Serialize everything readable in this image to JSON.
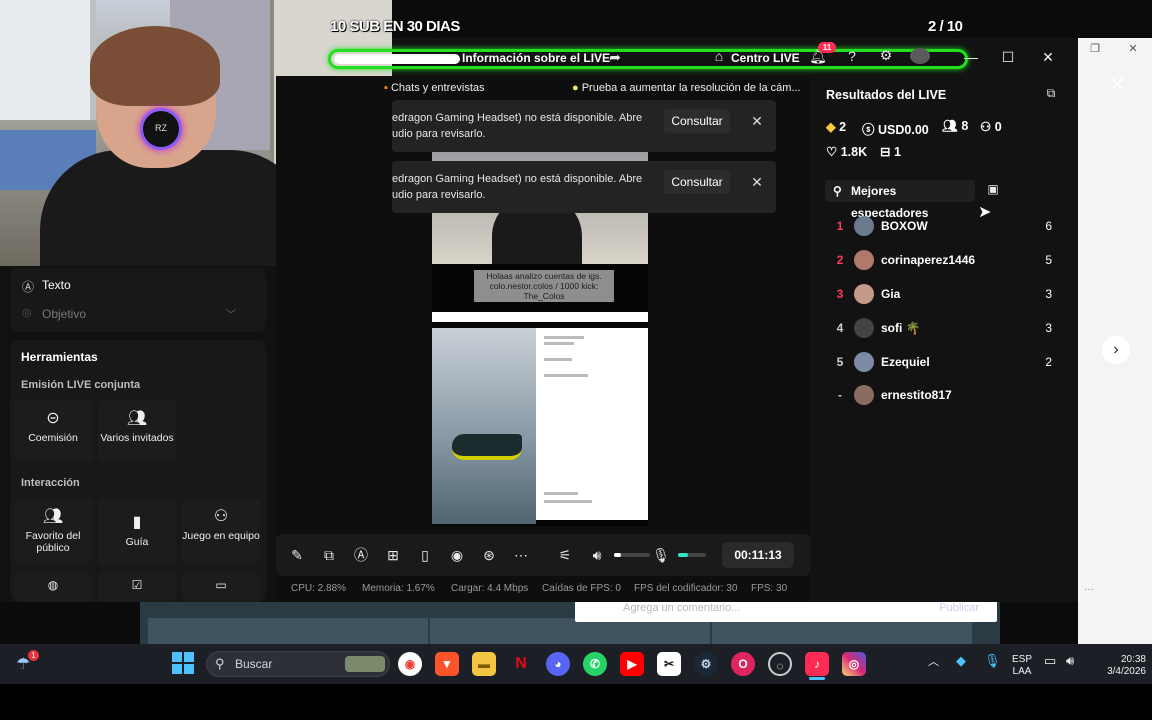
{
  "overlay": {
    "goal_text": "10 SUB EN 30 DIAS",
    "goal_count": "2 / 10",
    "goal_progress": 0.2
  },
  "topbar": {
    "live_info": "Información sobre el LIVE",
    "centro_live": "Centro LIVE",
    "notif_count": "11"
  },
  "subbar": {
    "chats": "Chats y entrevistas",
    "tip": "Prueba a aumentar la resolución de la cám..."
  },
  "notices": [
    {
      "text1": "edragon Gaming Headset) no está disponible. Abre",
      "text2": "udio para revisarlo.",
      "button": "Consultar"
    },
    {
      "text1": "edragon Gaming Headset) no está disponible. Abre",
      "text2": "udio para revisarlo.",
      "button": "Consultar"
    }
  ],
  "preview": {
    "caption": "Holaas analizo cuentas de igs. colo.nestor.colos / 1000 kick: The_Colos"
  },
  "left_panel": {
    "texto": "Texto",
    "objetivo": "Objetivo",
    "herramientas": "Herramientas",
    "emision": "Emisión LIVE conjunta",
    "coemision": "Coemisión",
    "varios": "Varios invitados",
    "interaccion": "Interacción",
    "favorito": "Favorito del público",
    "guia": "Guía",
    "juego": "Juego en equipo"
  },
  "controls": {
    "timer": "00:11:13",
    "volume_level": 0.2,
    "mic_level": 0.35
  },
  "stats": {
    "cpu": "CPU: 2.88%",
    "memoria": "Memoria: 1.67%",
    "cargar": "Cargar: 4.4 Mbps",
    "caidas": "Caídas de FPS: 0",
    "fps_cod": "FPS del codificador: 30",
    "fps": "FPS: 30"
  },
  "results": {
    "title": "Resultados del LIVE",
    "diamonds": "2",
    "usd": "USD0.00",
    "viewers": "8",
    "new_followers": "0",
    "likes": "1.8K",
    "shares": "1",
    "tab": "Mejores espectadores",
    "ranking": [
      {
        "rank": "1",
        "name": "BOXOW",
        "score": "6",
        "rank_color": "#ff3b5c",
        "avatar_color": "#6b7a8f"
      },
      {
        "rank": "2",
        "name": "corinaperez1446",
        "score": "5",
        "rank_color": "#ff3b5c",
        "avatar_color": "#b07a6a"
      },
      {
        "rank": "3",
        "name": "Gia",
        "score": "3",
        "rank_color": "#ff3b5c",
        "avatar_color": "#c49a8a"
      },
      {
        "rank": "4",
        "name": "sofi 🌴",
        "score": "3",
        "rank_color": "#cfcfcf",
        "avatar_color": "#444"
      },
      {
        "rank": "5",
        "name": "Ezequiel",
        "score": "2",
        "rank_color": "#cfcfcf",
        "avatar_color": "#7d8aa3"
      },
      {
        "rank": "-",
        "name": "ernestito817",
        "score": "",
        "rank_color": "#cfcfcf",
        "avatar_color": "#8a6d60"
      }
    ]
  },
  "background": {
    "comment_placeholder": "Agrega un comentario...",
    "publish": "Publicar"
  },
  "taskbar": {
    "search": "Buscar",
    "weather_badge": "1",
    "lang1": "ESP",
    "lang2": "LAA",
    "time": "20:38",
    "date": "3/4/2026"
  },
  "colors": {
    "goal_border": "#22e01f",
    "accent": "#ff2d55",
    "rank_top": "#ff3b5c"
  }
}
